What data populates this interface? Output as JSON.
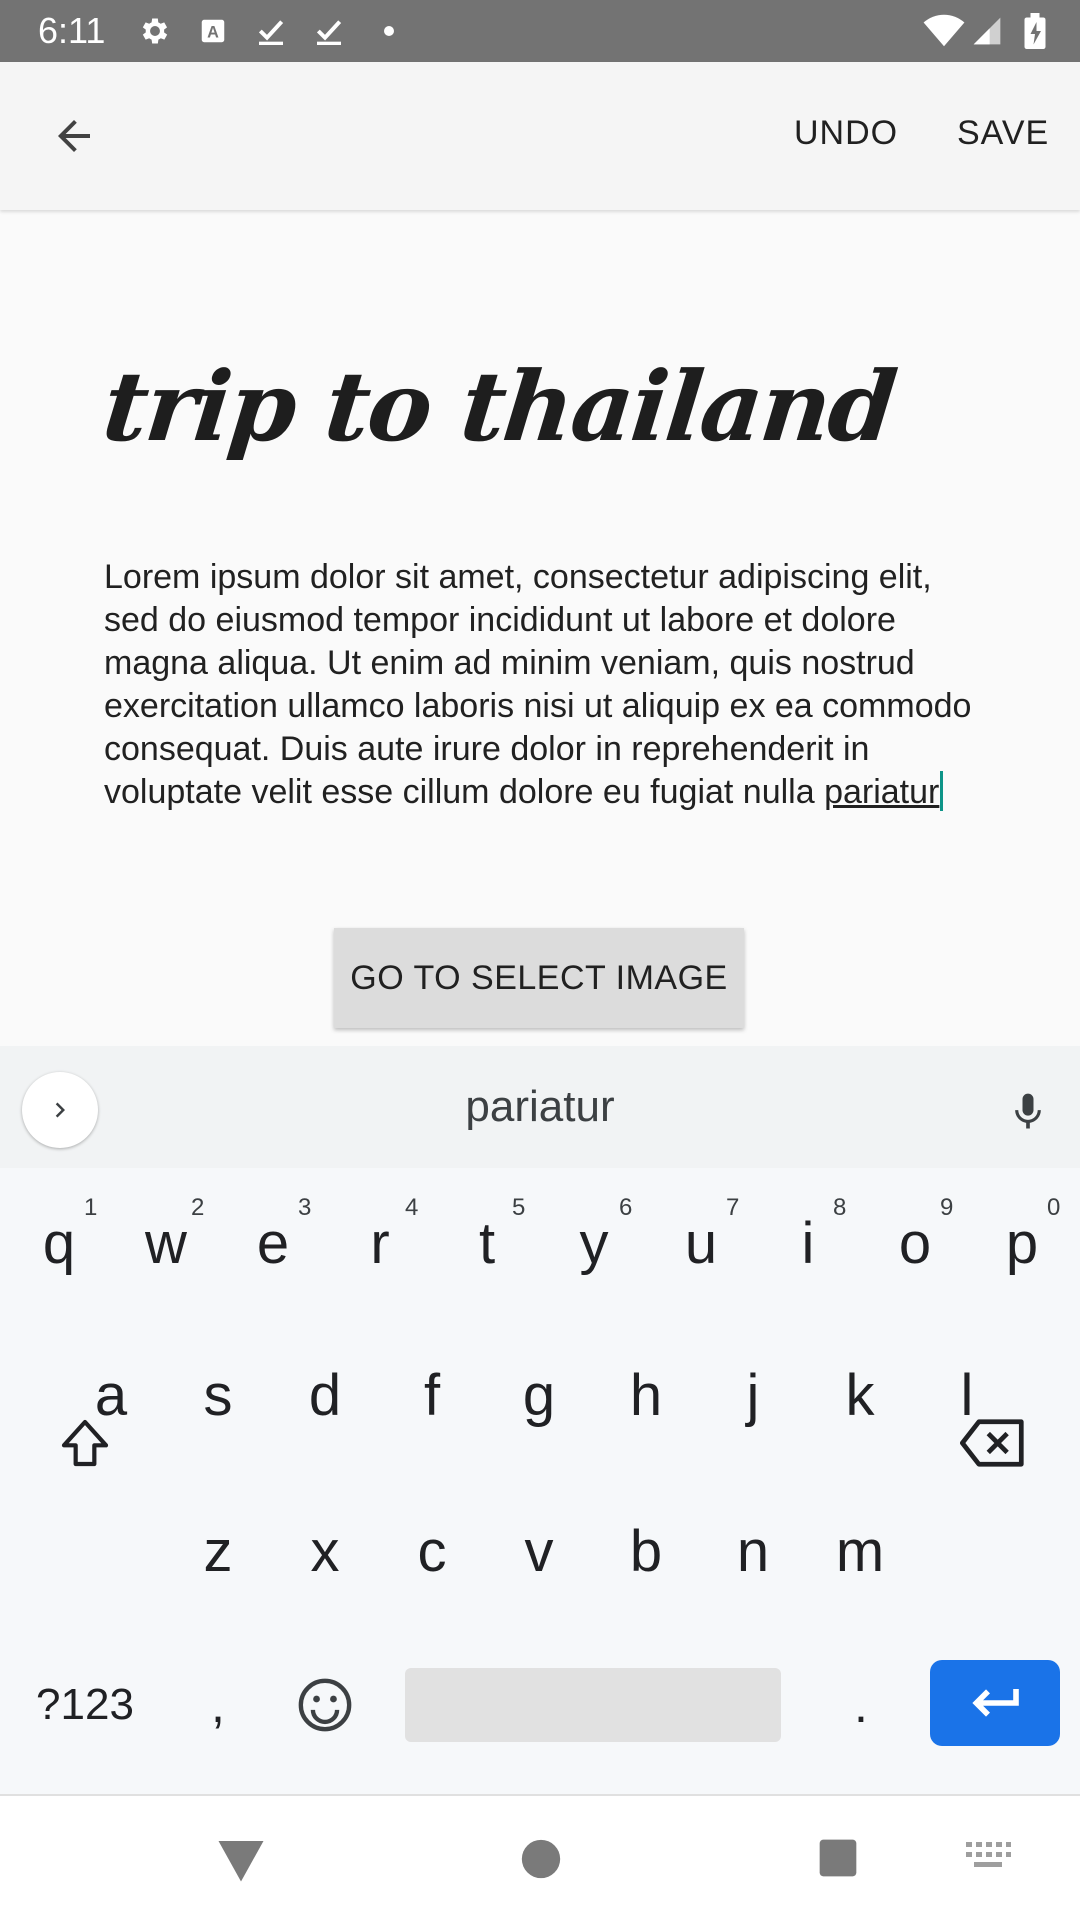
{
  "status_bar": {
    "time": "6:11",
    "icons": [
      "settings-icon",
      "text-a-icon",
      "check-icon",
      "check-icon",
      "dot-icon",
      "wifi-icon",
      "signal-icon",
      "battery-charging-icon"
    ]
  },
  "app_bar": {
    "back_icon": "arrow-back-icon",
    "undo_label": "UNDO",
    "save_label": "SAVE"
  },
  "content": {
    "title": "trip to thailand",
    "body_text": "Lorem ipsum dolor sit amet, consectetur adipiscing elit, sed do eiusmod tempor incididunt ut labore et dolore magna aliqua. Ut enim ad minim veniam, quis nostrud exercitation ullamco laboris nisi ut aliquip ex ea commodo consequat. Duis aute irure dolor in reprehenderit in voluptate velit esse cillum dolore eu fugiat nulla ",
    "current_word": "pariatur",
    "select_image_button": "GO TO SELECT IMAGE"
  },
  "keyboard": {
    "suggestion": "pariatur",
    "row1": [
      "q",
      "w",
      "e",
      "r",
      "t",
      "y",
      "u",
      "i",
      "o",
      "p"
    ],
    "row1_hints": [
      "1",
      "2",
      "3",
      "4",
      "5",
      "6",
      "7",
      "8",
      "9",
      "0"
    ],
    "row2": [
      "a",
      "s",
      "d",
      "f",
      "g",
      "h",
      "j",
      "k",
      "l"
    ],
    "row3": [
      "z",
      "x",
      "c",
      "v",
      "b",
      "n",
      "m"
    ],
    "symbols_label": "?123",
    "comma": ",",
    "period": ".",
    "accent_color": "#1a73e8"
  },
  "nav_bar": {
    "icons": [
      "back-triangle-icon",
      "home-circle-icon",
      "recents-square-icon",
      "keyboard-switch-icon"
    ]
  }
}
